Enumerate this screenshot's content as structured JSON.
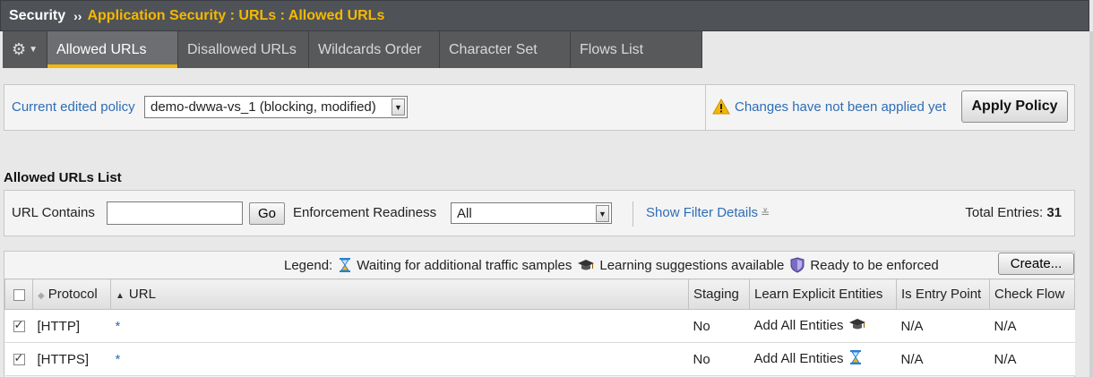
{
  "breadcrumb": {
    "root": "Security",
    "separator": "››",
    "path": "Application Security : URLs : Allowed URLs"
  },
  "tabs": [
    "Allowed URLs",
    "Disallowed URLs",
    "Wildcards Order",
    "Character Set",
    "Flows List"
  ],
  "active_tab": "Allowed URLs",
  "policy": {
    "label": "Current edited policy",
    "selected": "demo-dwwa-vs_1 (blocking, modified)",
    "notice": "Changes have not been applied yet",
    "apply_button": "Apply Policy"
  },
  "list": {
    "title": "Allowed URLs List",
    "filter": {
      "url_label": "URL Contains",
      "url_value": "",
      "go_button": "Go",
      "readiness_label": "Enforcement Readiness",
      "readiness_value": "All",
      "show_details": "Show Filter Details",
      "total_label": "Total Entries:",
      "total_value": "31"
    },
    "legend": {
      "label": "Legend:",
      "waiting": "Waiting for additional traffic samples",
      "learning": "Learning suggestions available",
      "ready": "Ready to be enforced"
    },
    "create_button": "Create...",
    "columns": [
      "Protocol",
      "URL",
      "Staging",
      "Learn Explicit Entities",
      "Is Entry Point",
      "Check Flow"
    ],
    "rows": [
      {
        "checked": true,
        "protocol": "[HTTP]",
        "url": "*",
        "staging": "No",
        "learn": "Add All Entities",
        "learn_icon": "learning-suggestions-icon",
        "entry": "N/A",
        "flow": "N/A"
      },
      {
        "checked": true,
        "protocol": "[HTTPS]",
        "url": "*",
        "staging": "No",
        "learn": "Add All Entities",
        "learn_icon": "hourglass-icon",
        "entry": "N/A",
        "flow": "N/A"
      }
    ]
  },
  "colors": {
    "title_bar": "#4f5358",
    "accent": "#f5b800",
    "link": "#2d6db5",
    "tab_bar": "#58595b"
  }
}
